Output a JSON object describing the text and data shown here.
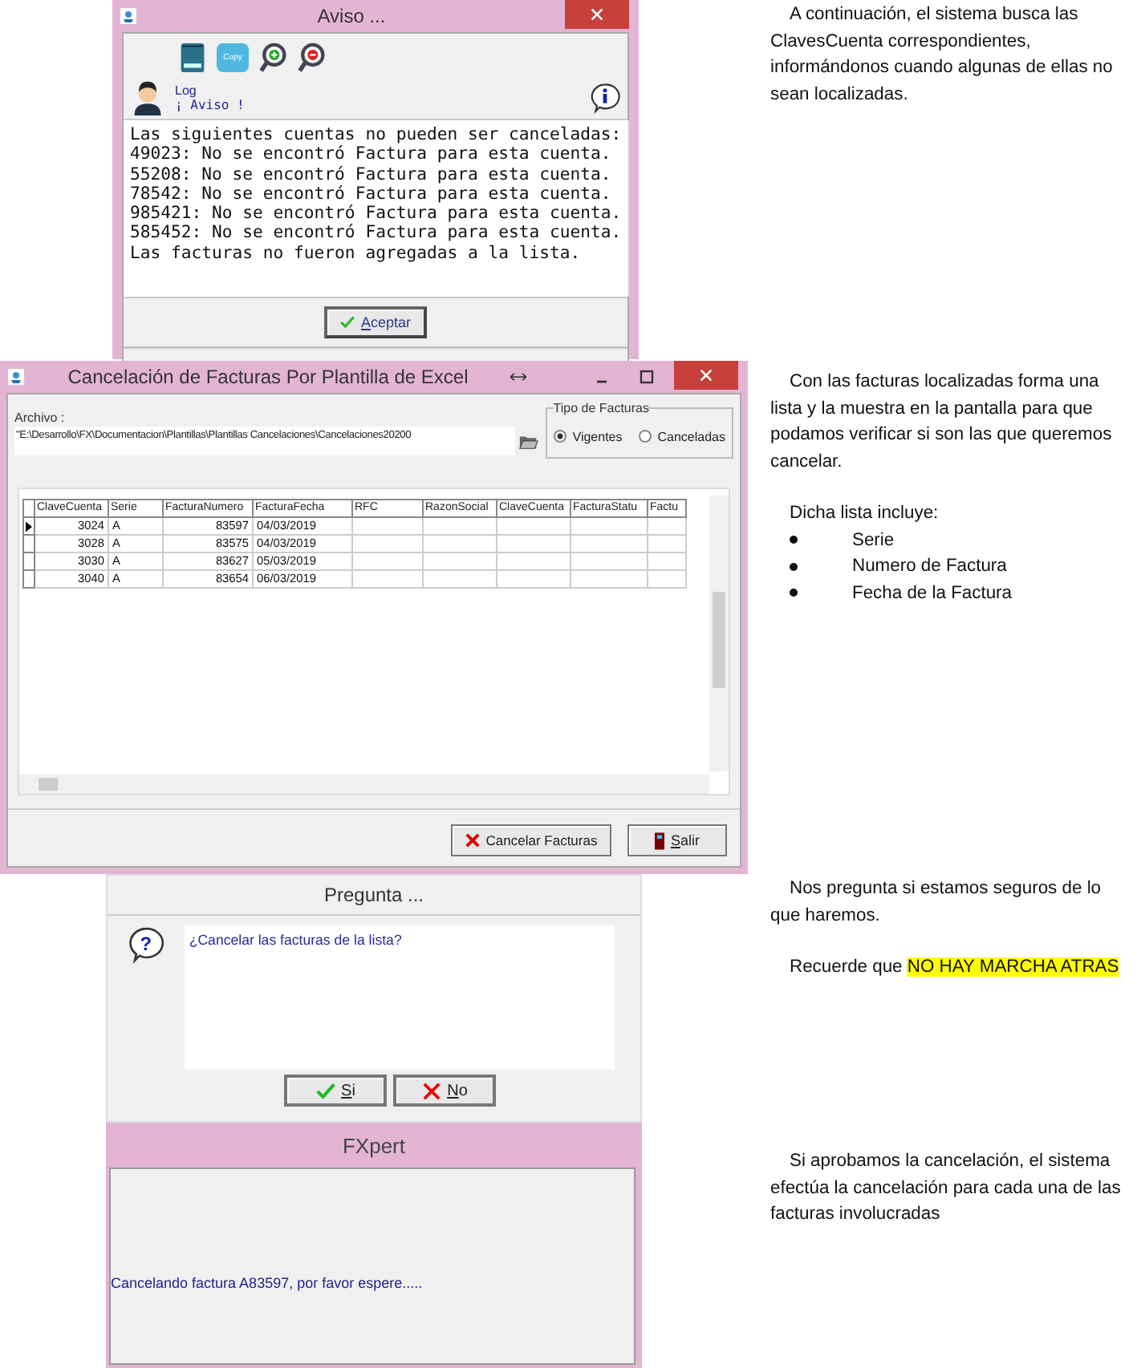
{
  "aviso_window": {
    "title": "Aviso ...",
    "toolbar": {
      "copy_label": "Copy"
    },
    "log_label": "Log",
    "aviso_label": "¡ Aviso !",
    "message_lines": [
      "Las siguientes cuentas no pueden ser canceladas:",
      "49023: No se encontró Factura para esta cuenta.",
      "55208: No se encontró Factura para esta cuenta.",
      "78542: No se encontró Factura para esta cuenta.",
      "985421: No se encontró Factura para esta cuenta.",
      "585452: No se encontró Factura para esta cuenta.",
      "Las facturas no fueron agregadas a la lista."
    ],
    "button": "Aceptar"
  },
  "note_1": "A continuación, el sistema busca las ClavesCuenta correspondientes, informándonos cuando algunas de ellas no sean localizadas.",
  "cancel_window": {
    "title": "Cancelación de Facturas Por Plantilla de Excel",
    "file_label": "Archivo :",
    "file_value": "\"E:\\Desarrollo\\FX\\Documentacion\\Plantillas\\Plantillas Cancelaciones\\Cancelaciones20200",
    "invoice_type": {
      "title": "Tipo de Facturas",
      "options": [
        {
          "label": "Vigentes",
          "selected": true
        },
        {
          "label": "Canceladas",
          "selected": false
        }
      ]
    },
    "table": {
      "columns": [
        "ClaveCuenta",
        "Serie",
        "FacturaNumero",
        "FacturaFecha",
        "RFC",
        "RazonSocial",
        "ClaveCuenta",
        "FacturaStatu",
        "Factu"
      ],
      "rows": [
        {
          "selected": true,
          "cells": [
            "3024",
            "A",
            "83597",
            "04/03/2019"
          ]
        },
        {
          "selected": false,
          "cells": [
            "3028",
            "A",
            "83575",
            "04/03/2019"
          ]
        },
        {
          "selected": false,
          "cells": [
            "3030",
            "A",
            "83627",
            "05/03/2019"
          ]
        },
        {
          "selected": false,
          "cells": [
            "3040",
            "A",
            "83654",
            "06/03/2019"
          ]
        }
      ]
    },
    "buttons": [
      {
        "kind": "cancel",
        "label": "Cancelar Facturas"
      },
      {
        "kind": "exit",
        "label": "Salir"
      }
    ]
  },
  "note_2": {
    "paragraph": "Con las facturas localizadas forma una lista y la muestra en la pantalla para que podamos verificar si son las que queremos cancelar.",
    "list_title": "Dicha lista incluye:",
    "items": [
      "Serie",
      "Numero de Factura",
      "Fecha de la Factura"
    ]
  },
  "question_window": {
    "title": "Pregunta ...",
    "icon_glyph": "?",
    "question": "¿Cancelar las facturas de la lista?",
    "buttons": [
      {
        "kind": "yes",
        "label": "Si"
      },
      {
        "kind": "no",
        "label": "No"
      }
    ]
  },
  "note_3": {
    "paragraph": "Nos pregunta si estamos seguros de lo que haremos.",
    "reminder": "Recuerde que",
    "reminder_highlight": "NO HAY MARCHA ATRAS"
  },
  "progress_window": {
    "title": "FXpert",
    "message": "Cancelando factura A83597, por favor espere....."
  },
  "note_4": "Si aprobamos la cancelación, el sistema efectúa la cancelación para cada una de las facturas involucradas"
}
